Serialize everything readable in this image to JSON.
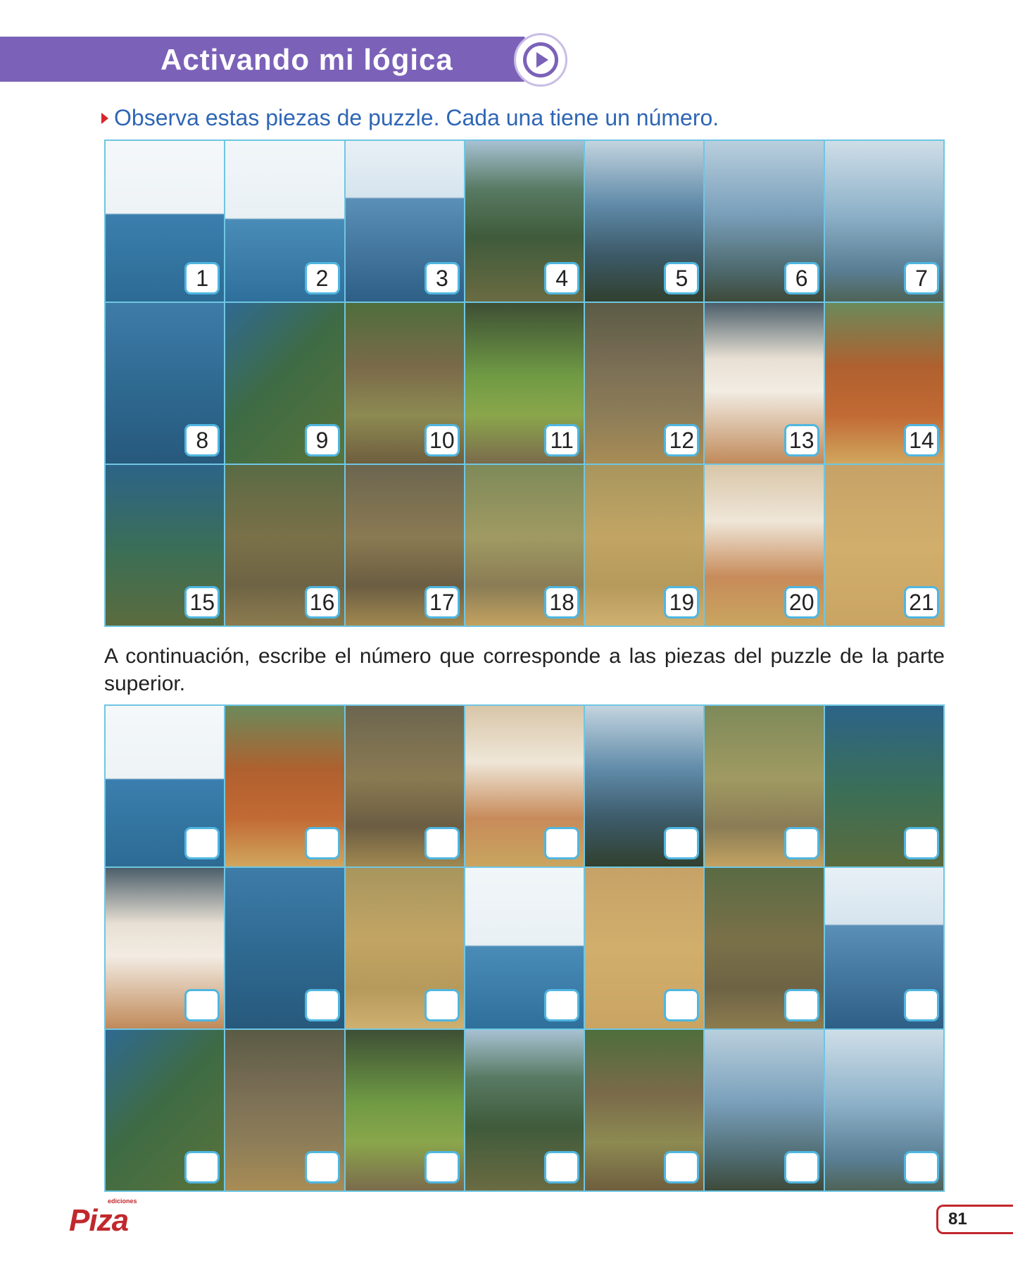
{
  "header": {
    "title": "Activando mi lógica"
  },
  "instruction": "Observa estas piezas de puzzle. Cada una tiene un número.",
  "puzzle_numbers": [
    "1",
    "2",
    "3",
    "4",
    "5",
    "6",
    "7",
    "8",
    "9",
    "10",
    "11",
    "12",
    "13",
    "14",
    "15",
    "16",
    "17",
    "18",
    "19",
    "20",
    "21"
  ],
  "paragraph": "A continuación, escribe el número que corresponde a las piezas del puzzle de la parte superior.",
  "footer": {
    "logo_small": "ediciones",
    "logo_brand": "Piza",
    "page_number": "81"
  },
  "colors": {
    "header": "#7b62b8",
    "instruction": "#2f66b5",
    "grid_line": "#6fc6e3",
    "brand_red": "#c1282d"
  }
}
